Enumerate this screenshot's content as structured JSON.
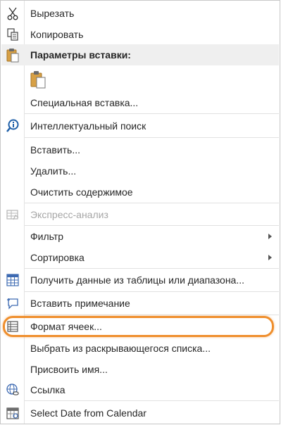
{
  "menu": {
    "cut": "Вырезать",
    "copy": "Копировать",
    "paste_options_header": "Параметры вставки:",
    "paste_special": "Специальная вставка...",
    "smart_lookup": "Интеллектуальный поиск",
    "insert": "Вставить...",
    "delete": "Удалить...",
    "clear_contents": "Очистить содержимое",
    "quick_analysis": "Экспресс-анализ",
    "filter": "Фильтр",
    "sort": "Сортировка",
    "get_data": "Получить данные из таблицы или диапазона...",
    "insert_comment": "Вставить примечание",
    "format_cells": "Формат ячеек...",
    "pick_from_list": "Выбрать из раскрывающегося списка...",
    "define_name": "Присвоить имя...",
    "link": "Ссылка",
    "select_date": "Select Date from Calendar"
  },
  "colors": {
    "highlight_ring": "#ef8e2c",
    "header_bg": "#efefef",
    "disabled_text": "#a6a6a6"
  }
}
